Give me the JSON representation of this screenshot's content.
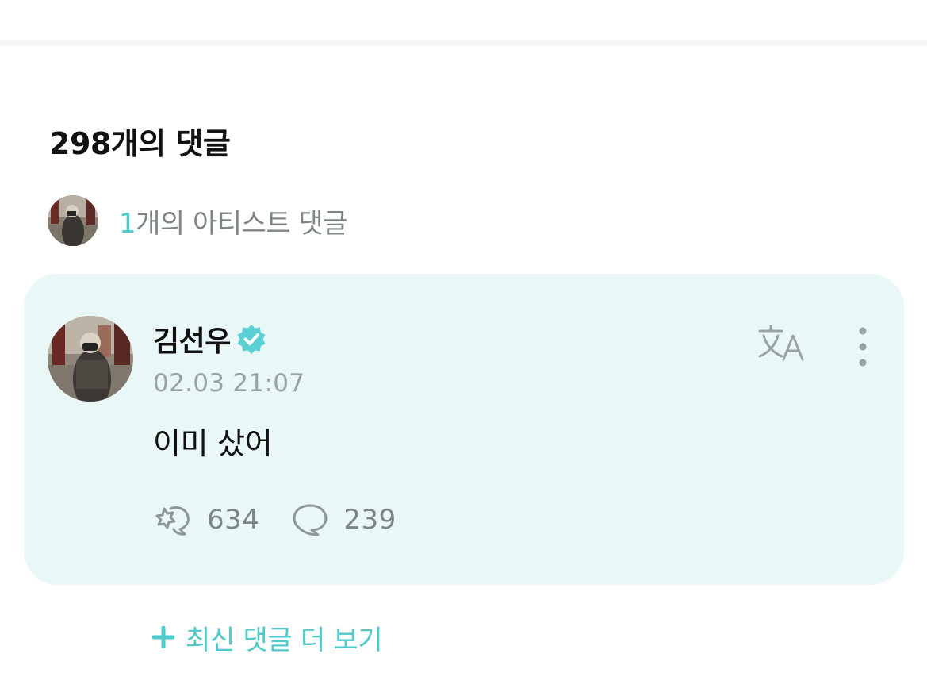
{
  "comments": {
    "title": "298개의 댓글",
    "artist_summary": {
      "count": "1",
      "label": "개의 아티스트 댓글"
    }
  },
  "artist_comment": {
    "author": "김선우",
    "timestamp": "02.03 21:07",
    "body": "이미 샀어",
    "likes": "634",
    "replies": "239",
    "icons": {
      "verified": "verified-badge-icon",
      "translate": "translate-icon",
      "more": "more-vertical-icon",
      "like": "like-icon",
      "reply": "comment-bubble-icon"
    }
  },
  "more_comments": {
    "label": "최신 댓글 더 보기",
    "icon": "plus-icon"
  },
  "colors": {
    "accent": "#4fc9c9",
    "card_background": "#e9f8f7",
    "muted_text": "#7e8585"
  }
}
